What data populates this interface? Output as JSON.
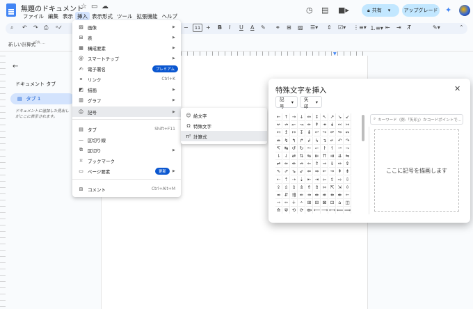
{
  "title_bar": {
    "doc_title": "無題のドキュメント",
    "menus": [
      "ファイル",
      "編集",
      "表示",
      "挿入",
      "表示形式",
      "ツール",
      "拡張機能",
      "ヘルプ"
    ],
    "share_label": "共有",
    "upgrade_label": "アップグレード"
  },
  "toolbar": {
    "font_size": "11"
  },
  "ruler": {
    "label": "新しい計算式",
    "fx": "xPA ..."
  },
  "outline": {
    "title": "ドキュメント タブ",
    "tab_label": "タブ 1",
    "hint": "ドキュメントに追加した見出しがここに表示されます。"
  },
  "insert_menu": {
    "items": [
      {
        "label": "画像",
        "icon": "image-icon",
        "arrow": true
      },
      {
        "label": "表",
        "icon": "table-icon",
        "arrow": true
      },
      {
        "label": "構成要素",
        "icon": "building-blocks-icon",
        "arrow": true
      },
      {
        "label": "スマートチップ",
        "icon": "smart-chip-icon",
        "arrow": true
      },
      {
        "label": "電子署名",
        "icon": "signature-icon",
        "badge": "プレミアム"
      },
      {
        "label": "リンク",
        "icon": "link-icon",
        "shortcut": "Ctrl+K"
      },
      {
        "label": "描画",
        "icon": "drawing-icon",
        "arrow": true
      },
      {
        "label": "グラフ",
        "icon": "chart-icon",
        "arrow": true
      },
      {
        "label": "記号",
        "icon": "omega-icon",
        "arrow": true,
        "active": true
      },
      {
        "label": "タブ",
        "icon": "tab-icon",
        "shortcut": "Shift+F11"
      },
      {
        "label": "区切り線",
        "icon": "horizontal-line-icon"
      },
      {
        "label": "区切り",
        "icon": "break-icon",
        "arrow": true
      },
      {
        "label": "ブックマーク",
        "icon": "bookmark-icon"
      },
      {
        "label": "ページ要素",
        "icon": "page-elements-icon",
        "badge": "更新",
        "arrow": true
      },
      {
        "label": "コメント",
        "icon": "comment-icon",
        "shortcut": "Ctrl+Alt+M"
      }
    ]
  },
  "sub_menu": {
    "items": [
      {
        "label": "絵文字",
        "icon": "emoji-icon"
      },
      {
        "label": "特殊文字",
        "icon": "omega-icon"
      },
      {
        "label": "計算式",
        "icon": "pi-icon"
      }
    ]
  },
  "dialog": {
    "title": "特殊文字を挿入",
    "category": "記号",
    "subcategory": "矢印",
    "search_placeholder": "キーワード（例:「矢印」）かコードポイントで...",
    "draw_hint": "ここに記号を描画します",
    "symbols": [
      "←",
      "↑",
      "→",
      "↓",
      "↔",
      "↕",
      "↖",
      "↗",
      "↘",
      "↙",
      "↚",
      "↛",
      "↜",
      "↝",
      "↞",
      "↟",
      "↠",
      "↡",
      "↢",
      "↣",
      "↤",
      "↥",
      "↦",
      "↧",
      "↨",
      "↩",
      "↪",
      "↫",
      "↬",
      "↭",
      "↮",
      "↯",
      "↰",
      "↱",
      "↲",
      "↳",
      "↴",
      "↵",
      "↶",
      "↷",
      "↸",
      "↹",
      "↺",
      "↻",
      "↼",
      "↽",
      "↾",
      "↿",
      "⇀",
      "⇁",
      "⇂",
      "⇃",
      "⇄",
      "⇅",
      "⇆",
      "⇇",
      "⇈",
      "⇉",
      "⇊",
      "⇋",
      "⇌",
      "⇍",
      "⇎",
      "⇏",
      "⇐",
      "⇑",
      "⇒",
      "⇓",
      "⇔",
      "⇕",
      "⇖",
      "⇗",
      "⇘",
      "⇙",
      "⇚",
      "⇛",
      "⇜",
      "⇝",
      "⇞",
      "⇟",
      "⇠",
      "⇡",
      "⇢",
      "⇣",
      "⇤",
      "⇥",
      "⇦",
      "⇧",
      "⇨",
      "⇩",
      "⇪",
      "⇫",
      "⇬",
      "⇭",
      "⇮",
      "⇯",
      "⇰",
      "⇱",
      "⇲",
      "⇳",
      "⇴",
      "⇵",
      "⇶",
      "⇷",
      "⇸",
      "⇹",
      "⇺",
      "⇻",
      "⇼",
      "⇽",
      "⇾",
      "⇿",
      "∔",
      "∸",
      "⊞",
      "⊟",
      "⊠",
      "⊡",
      "⌂",
      "◫",
      "⟰",
      "⟱",
      "⟲",
      "⟳",
      "⟴",
      "⟵",
      "⟶",
      "⟷",
      "⟸",
      "⟹"
    ]
  }
}
